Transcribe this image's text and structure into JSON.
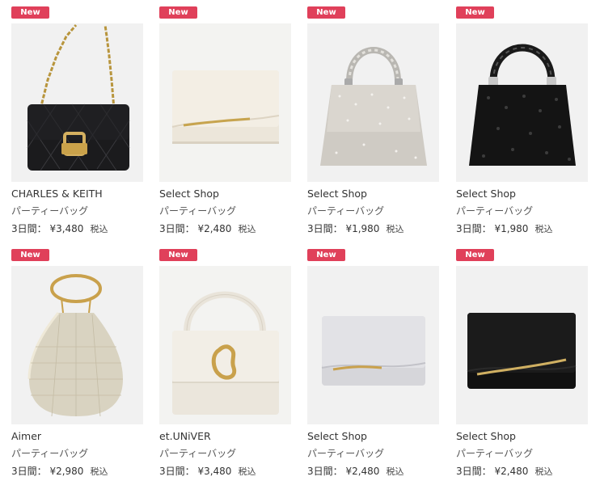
{
  "products": [
    {
      "badge": "New",
      "brand": "CHARLES & KEITH",
      "category": "パーティーバッグ",
      "price": "3日間： ¥3,480",
      "tax": "税込",
      "image": "black-quilted-chain-bag"
    },
    {
      "badge": "New",
      "brand": "Select Shop",
      "category": "パーティーバッグ",
      "price": "3日間： ¥2,480",
      "tax": "税込",
      "image": "ivory-clutch-gold-bar"
    },
    {
      "badge": "New",
      "brand": "Select Shop",
      "category": "パーティーバッグ",
      "price": "3日間： ¥1,980",
      "tax": "税込",
      "image": "silver-crystal-handbag"
    },
    {
      "badge": "New",
      "brand": "Select Shop",
      "category": "パーティーバッグ",
      "price": "3日間： ¥1,980",
      "tax": "税込",
      "image": "black-crystal-handbag"
    },
    {
      "badge": "New",
      "brand": "Aimer",
      "category": "パーティーバッグ",
      "price": "3日間： ¥2,980",
      "tax": "税込",
      "image": "gold-mesh-pouch-ring-handle"
    },
    {
      "badge": "New",
      "brand": "et.UNiVER",
      "category": "パーティーバッグ",
      "price": "3日間： ¥3,480",
      "tax": "税込",
      "image": "ivory-bag-gold-buckle"
    },
    {
      "badge": "New",
      "brand": "Select Shop",
      "category": "パーティーバッグ",
      "price": "3日間： ¥2,480",
      "tax": "税込",
      "image": "silver-satin-clutch"
    },
    {
      "badge": "New",
      "brand": "Select Shop",
      "category": "パーティーバッグ",
      "price": "3日間： ¥2,480",
      "tax": "税込",
      "image": "black-velvet-clutch"
    }
  ],
  "colors": {
    "badge": "#e0405a",
    "text": "#333333"
  }
}
